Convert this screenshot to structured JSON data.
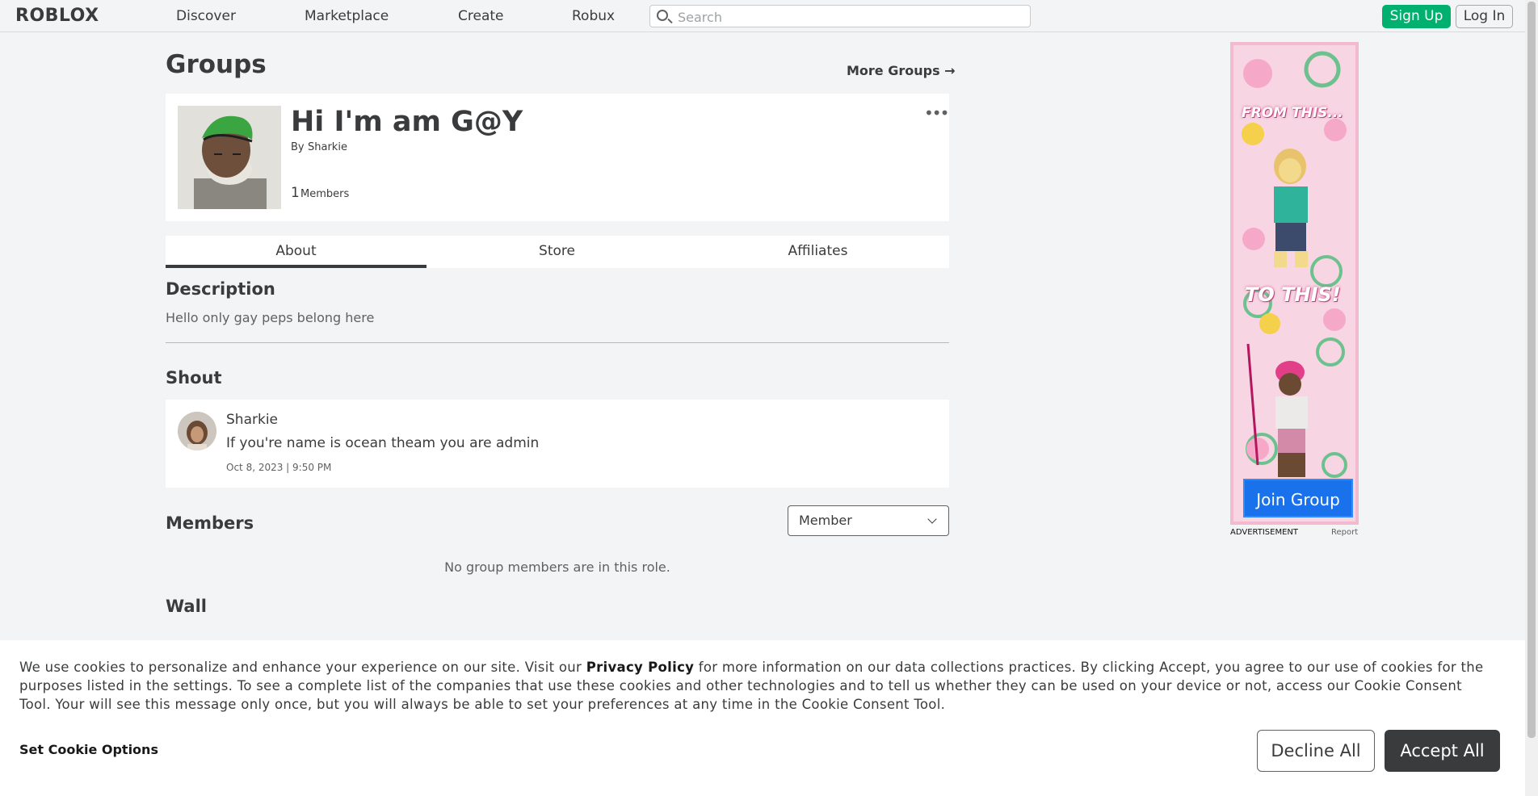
{
  "nav": {
    "logo": "ROBLOX",
    "links": [
      "Discover",
      "Marketplace",
      "Create",
      "Robux"
    ],
    "search_placeholder": "Search",
    "signup": "Sign Up",
    "login": "Log In"
  },
  "page": {
    "title": "Groups",
    "more_groups": "More Groups →"
  },
  "group": {
    "name": "Hi I'm am G@Y",
    "by_prefix": "By",
    "owner": "Sharkie",
    "member_count": "1",
    "member_label": "Members",
    "menu": "•••"
  },
  "tabs": [
    "About",
    "Store",
    "Affiliates"
  ],
  "about": {
    "description_heading": "Description",
    "description": "Hello only gay peps belong here",
    "shout_heading": "Shout",
    "shout": {
      "author": "Sharkie",
      "message": "If you're name is ocean theam you are admin",
      "date": "Oct 8, 2023 | 9:50 PM"
    },
    "members_heading": "Members",
    "role_selected": "Member",
    "no_members": "No group members are in this role.",
    "wall_heading": "Wall"
  },
  "ad": {
    "top_text": "FROM THIS...",
    "mid_text": "TO THIS!",
    "button": "Join Group",
    "label": "ADVERTISEMENT",
    "report": "Report"
  },
  "cookie": {
    "text_before": "We use cookies to personalize and enhance your experience on our site. Visit our ",
    "privacy_link": "Privacy Policy",
    "text_after": " for more information on our data collections practices. By clicking Accept, you agree to our use of cookies for the purposes listed in the settings. To see a complete list of the companies that use these cookies and other technologies and to tell us whether they can be used on your device or not, access our Cookie Consent Tool. Your will see this message only once, but you will always be able to set your preferences at any time in the Cookie Consent Tool.",
    "set_options": "Set Cookie Options",
    "decline": "Decline All",
    "accept": "Accept All"
  },
  "colors": {
    "background": "#f2f4f5",
    "signup_green": "#00b06f",
    "accept_dark": "#393b3d",
    "join_blue": "#1971ec",
    "ad_pink": "#f7d5e2"
  }
}
